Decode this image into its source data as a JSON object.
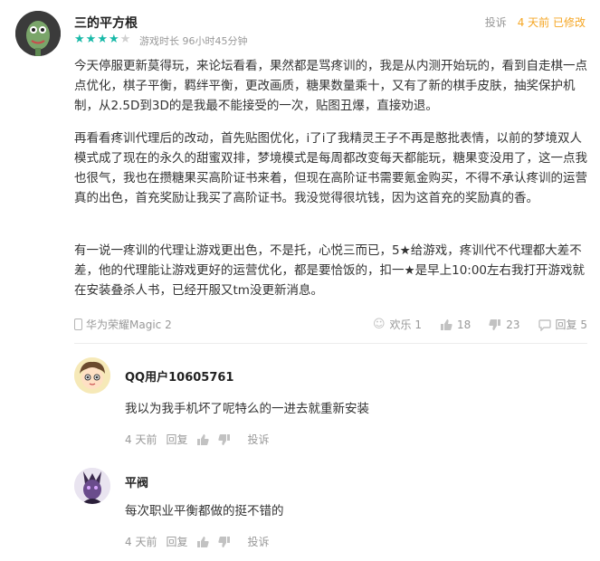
{
  "review": {
    "author": "三的平方根",
    "rating": 4,
    "rating_max": 5,
    "playtime": "游戏时长 96小时45分钟",
    "report_label": "投诉",
    "edited_label": "4 天前 已修改",
    "paragraphs": [
      "今天停服更新莫得玩，来论坛看看，果然都是骂疼训的，我是从内测开始玩的，看到自走棋一点点优化，棋子平衡，羁绊平衡，更改画质，糖果数量乘十，又有了新的棋手皮肤，抽奖保护机制，从2.5D到3D的是我最不能接受的一次，贴图丑爆，直接劝退。",
      "再看看疼训代理后的改动，首先贴图优化，i了i了我精灵王子不再是憨批表情，以前的梦境双人模式成了现在的永久的甜蜜双排，梦境模式是每周都改变每天都能玩，糖果变没用了，这一点我也很气，我也在攒糖果买高阶证书来着，但现在高阶证书需要氪金购买，不得不承认疼训的运营真的出色，首充奖励让我买了高阶证书。我没觉得很坑钱，因为这首充的奖励真的香。",
      "有一说一疼训的代理让游戏更出色，不是托，心悦三而已，5★给游戏，疼训代不代理都大差不差，他的代理能让游戏更好的运营优化，都是要恰饭的，扣一★是早上10:00左右我打开游戏就在安装叠杀人书，已经开服又tm没更新消息。"
    ],
    "device": "华为荣耀Magic 2",
    "actions": {
      "funny_label": "欢乐 1",
      "like_count": "18",
      "dislike_count": "23",
      "reply_label": "回复 5"
    }
  },
  "replies": [
    {
      "author": "QQ用户10605761",
      "text": "我以为我手机坏了呢特么的一进去就重新安装",
      "time": "4 天前",
      "reply_label": "回复",
      "report_label": "投诉"
    },
    {
      "author": "平阀",
      "text": "每次职业平衡都做的挺不错的",
      "time": "4 天前",
      "reply_label": "回复",
      "report_label": "投诉"
    }
  ],
  "colors": {
    "star": "#18b9a8",
    "edited": "#f5a623",
    "muted": "#999999"
  }
}
